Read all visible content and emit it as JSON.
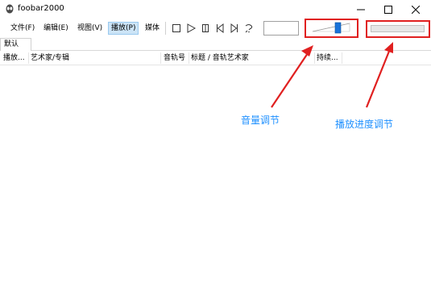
{
  "window": {
    "title": "foobar2000",
    "icon": "alien-head-icon",
    "controls": [
      "minimize-icon",
      "maximize-icon",
      "close-icon"
    ]
  },
  "menu": {
    "items": [
      {
        "label": "文件(F)"
      },
      {
        "label": "编辑(E)"
      },
      {
        "label": "视图(V)"
      },
      {
        "label": "播放(P)",
        "active": true
      },
      {
        "label": "媒体"
      }
    ]
  },
  "playback_buttons": [
    "stop-icon",
    "play-icon",
    "pause-icon",
    "previous-icon",
    "next-icon",
    "random-icon"
  ],
  "tabs": [
    {
      "label": "默认"
    }
  ],
  "playlist": {
    "columns": [
      "播放...",
      "艺术家/专辑",
      "音轨号",
      "标题 / 音轨艺术家",
      "持续..."
    ],
    "rows": []
  },
  "annotations": {
    "volume": "音量调节",
    "seek": "播放进度调节",
    "color": "#e02020",
    "text_color": "#1e90ff"
  }
}
